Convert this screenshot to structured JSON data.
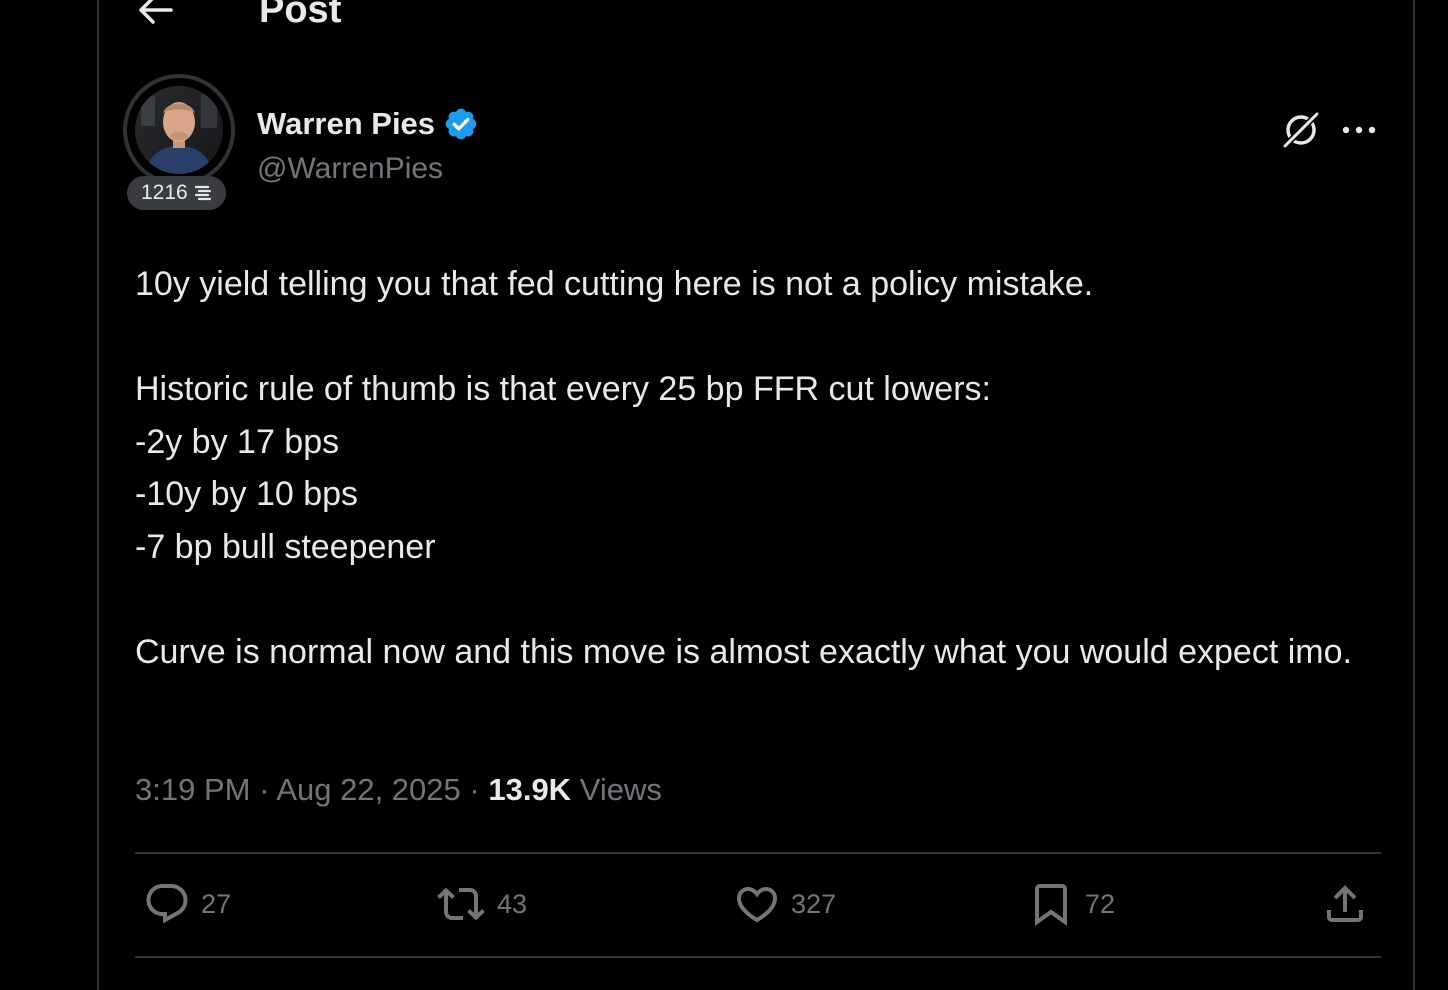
{
  "header": {
    "title": "Post"
  },
  "author": {
    "name": "Warren Pies",
    "handle": "@WarrenPies",
    "score": "1216",
    "verified_color": "#1d9bf0"
  },
  "tweet": {
    "paragraphs": [
      [
        "10y yield telling you that fed cutting here is not a policy mistake."
      ],
      [
        "Historic rule of thumb is that every 25 bp FFR cut lowers:",
        "-2y by 17 bps",
        "-10y by 10 bps",
        "-7 bp bull steepener"
      ],
      [
        "Curve is normal now and this move is almost exactly what you would expect imo."
      ]
    ]
  },
  "meta": {
    "time": "3:19 PM",
    "date": "Aug 22, 2025",
    "views_count": "13.9K",
    "views_label": "Views",
    "separator": "·"
  },
  "actions": {
    "replies": "27",
    "reposts": "43",
    "likes": "327",
    "bookmarks": "72"
  },
  "colors": {
    "background": "#000000",
    "text_primary": "#e7e9ea",
    "text_secondary": "#71767b",
    "border": "#2f3336",
    "accent": "#1d9bf0"
  }
}
